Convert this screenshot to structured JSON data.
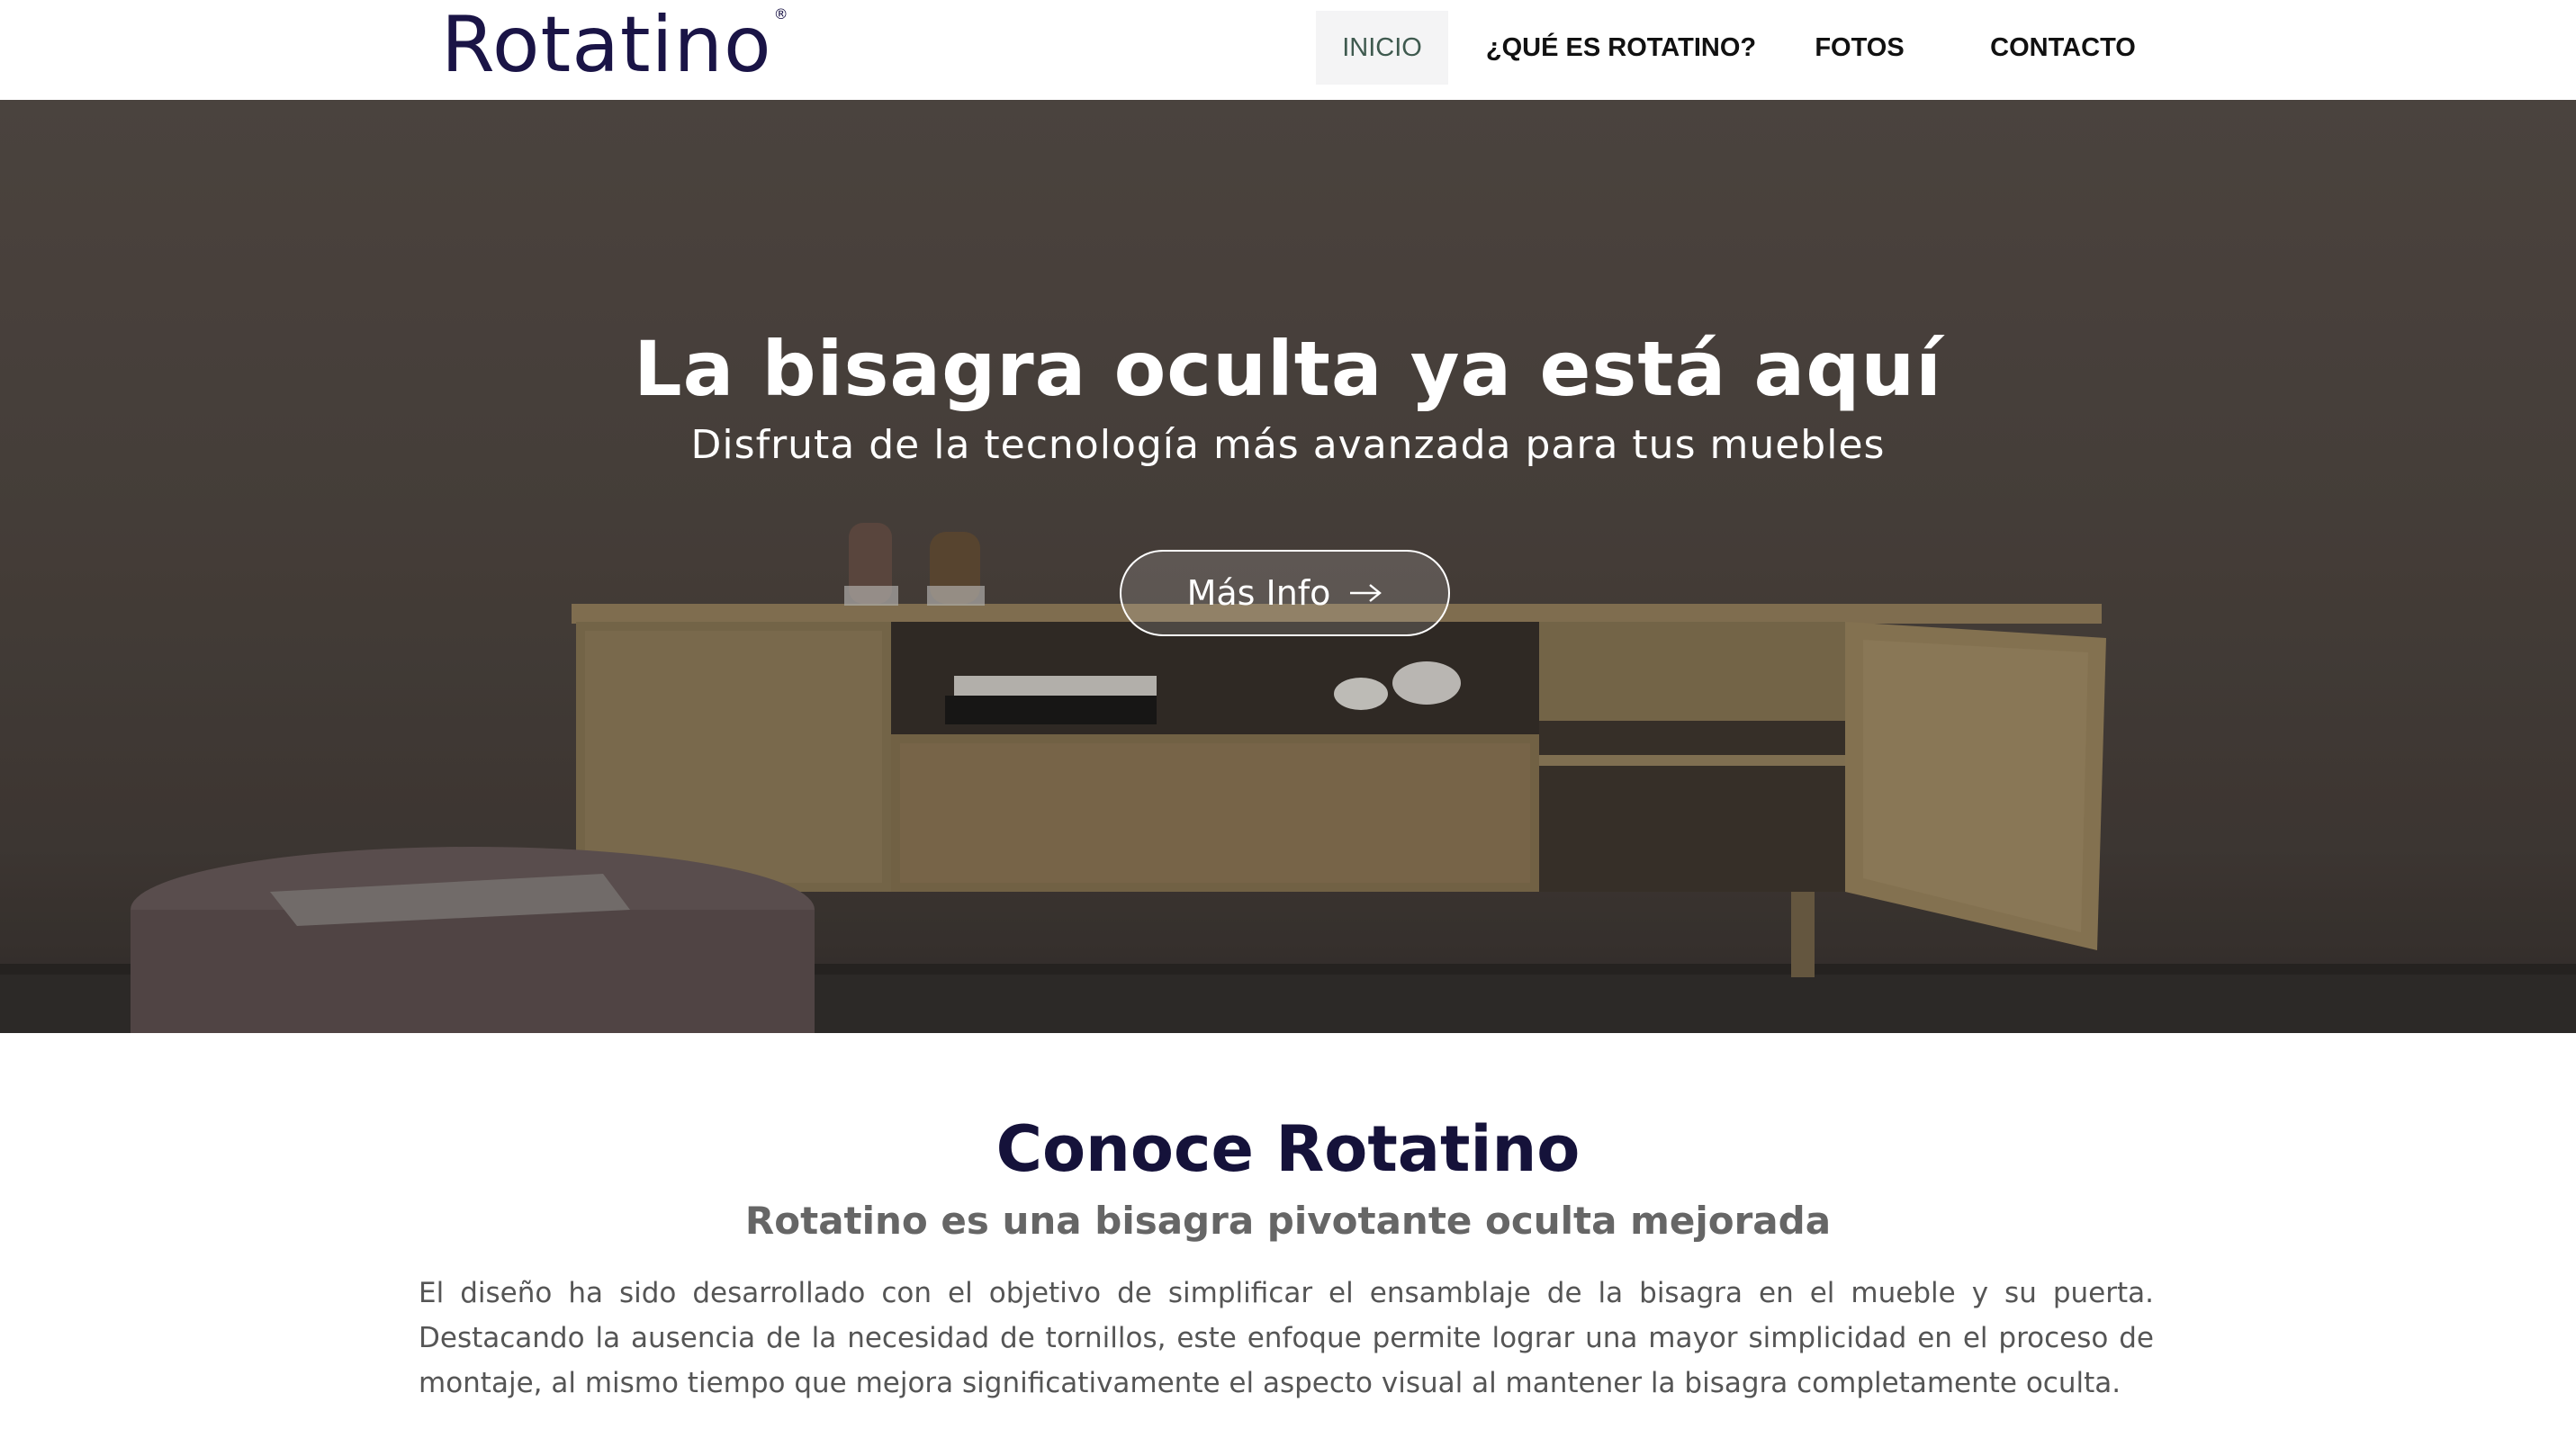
{
  "brand": {
    "logo_text": "Rotatino",
    "registered_mark": "®",
    "color": "#1a1446"
  },
  "nav": {
    "items": [
      {
        "label": "INICIO",
        "active": true
      },
      {
        "label": "¿QUÉ ES ROTATINO?",
        "active": false
      },
      {
        "label": "FOTOS",
        "active": false
      },
      {
        "label": "CONTACTO",
        "active": false
      }
    ]
  },
  "hero": {
    "title": "La bisagra oculta ya está aquí",
    "subtitle": "Disfruta de la tecnología más avanzada para tus muebles",
    "cta_label": "Más Info",
    "cta_icon": "arrow-right-icon"
  },
  "about": {
    "title": "Conoce Rotatino",
    "subtitle": "Rotatino es una bisagra pivotante oculta mejorada",
    "body": "El diseño ha sido desarrollado con el objetivo de simplificar el ensamblaje de la bisagra en el mueble y su puerta. Destacando la ausencia de la necesidad de tornillos, este enfoque permite lograr una mayor simplicidad en el proceso de montaje, al mismo tiempo que mejora significativamente el aspecto visual al mantener la bisagra completamente oculta."
  },
  "colors": {
    "title_dark": "#15123a",
    "subtitle_gray": "#666666",
    "nav_active_bg": "#f4f4f5",
    "nav_active_text": "#3f5a4f"
  }
}
